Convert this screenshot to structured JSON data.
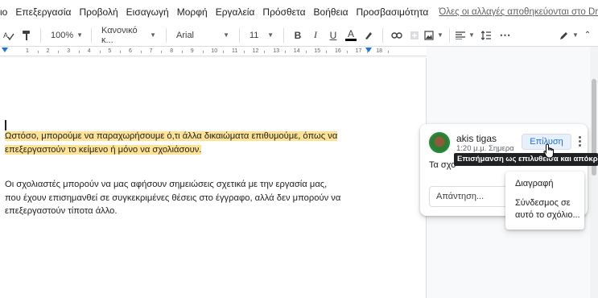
{
  "menubar": {
    "items": [
      "ιο",
      "Επεξεργασία",
      "Προβολή",
      "Εισαγωγή",
      "Μορφή",
      "Εργαλεία",
      "Πρόσθετα",
      "Βοήθεια",
      "Προσβασιμότητα"
    ],
    "saved_status": "Όλες οι αλλαγές αποθηκεύονται στο Drive"
  },
  "toolbar": {
    "zoom": "100%",
    "style": "Κανονικό κ...",
    "font": "Arial",
    "font_size": "11",
    "bold": "B",
    "italic": "I",
    "underline": "U",
    "text_color": "A",
    "colors": {
      "text_color_bar": "#000000",
      "accent": "#1a73e8"
    }
  },
  "ruler": {
    "numbers": [
      "1",
      "2",
      "3",
      "4",
      "5",
      "6",
      "7",
      "8",
      "9",
      "10",
      "11",
      "12",
      "13",
      "14",
      "15",
      "16",
      "17",
      "18"
    ]
  },
  "document": {
    "para1": "Ωστόσο, μπορούμε να παραχωρήσουμε ό,τι άλλα δικαιώματα επιθυμούμε, όπως να επεξεργαστούν το κείμενο ή μόνο να σχολιάσουν.",
    "para2": "Οι σχολιαστές μπορούν να μας αφήσουν σημειώσεις σχετικά με την εργασία μας, που έχουν επισημανθεί σε συγκεκριμένες θέσεις στο έγγραφο, αλλά δεν μπορούν να επεξεργαστούν τίποτα άλλο.",
    "highlight_color": "#fde293"
  },
  "comment": {
    "author": "akis tigas",
    "time": "1:20 μ.μ. Σημερα",
    "text": "Τα σχο",
    "resolve_label": "Επίλυση",
    "reply_placeholder": "Απάντηση...",
    "tooltip": "Επισήμανση ως επιλυθείσα και απόκρυψη"
  },
  "comment_menu": {
    "items": [
      "Διαγραφή",
      "Σύνδεσμος σε αυτό το σχόλιο..."
    ]
  }
}
